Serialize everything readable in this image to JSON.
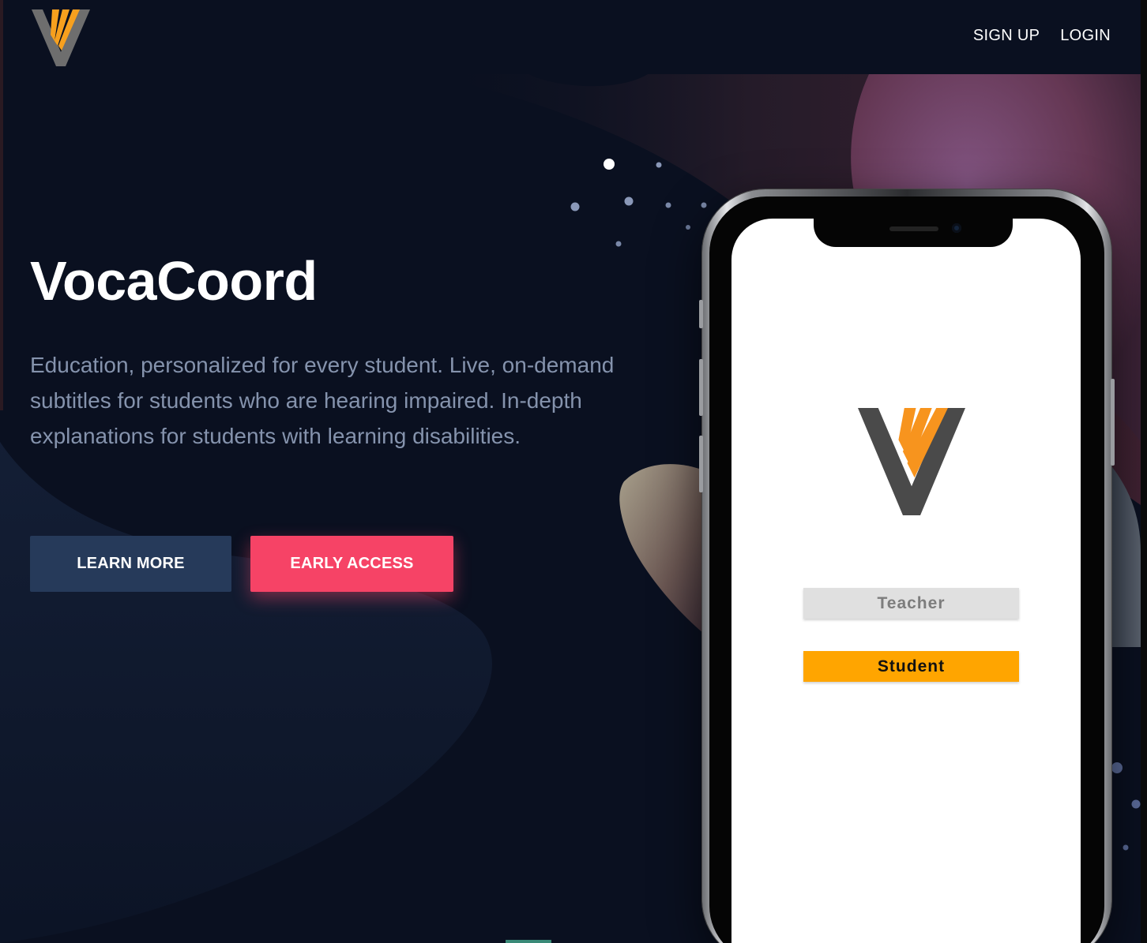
{
  "header": {
    "logo_icon": "vocacoord-v-logo",
    "nav": {
      "sign_up": "SIGN UP",
      "login": "LOGIN"
    }
  },
  "hero": {
    "title": "VocaCoord",
    "description": "Education, personalized for every student. Live, on-demand subtitles for students who are hearing impaired. In-depth explanations for students with learning disabilities.",
    "buttons": {
      "learn_more": "LEARN MORE",
      "early_access": "EARLY ACCESS"
    }
  },
  "phone_app": {
    "logo_icon": "vocacoord-v-logo",
    "teacher_button": "Teacher",
    "student_button": "Student"
  },
  "colors": {
    "background": "#0a1020",
    "accent_pink": "#f64366",
    "secondary_button": "#263a5a",
    "logo_orange": "#f7a01e",
    "logo_gray": "#6e6e6e",
    "student_orange": "#ffa500",
    "teacher_gray": "#e0e0e0"
  }
}
